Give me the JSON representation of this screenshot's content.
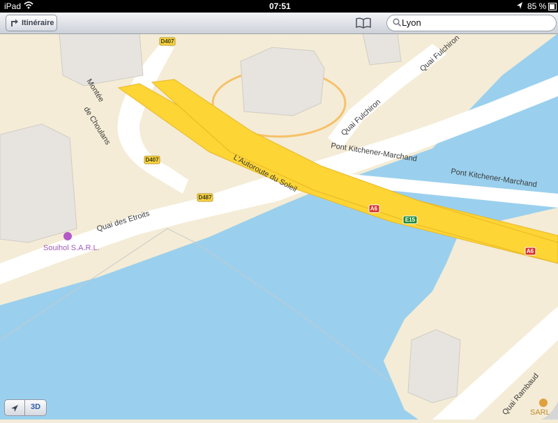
{
  "status": {
    "device": "iPad",
    "time": "07:51",
    "battery": "85 %",
    "wifi_icon": "wifi-icon",
    "location_icon": "location-arrow-icon"
  },
  "toolbar": {
    "directions_label": "Itinéraire",
    "bookmarks_icon": "bookmarks-icon",
    "search_value": "Lyon"
  },
  "map": {
    "streets": {
      "montee_1": "Montée",
      "montee_2": "de Choulans",
      "quai_fulchiron_1": "Quai Fulchiron",
      "quai_fulchiron_2": "Quai Fulchiron",
      "pont_1": "Pont Kitchener-Marchand",
      "pont_2": "Pont Kitchener-Marchand",
      "autoroute": "L'Autoroute du Soleil",
      "quai_etroits": "Quai des Etroits",
      "quai_rambaud": "Quai Rambaud"
    },
    "shields": {
      "d407_a": "D407",
      "d407_b": "D407",
      "d487": "D487",
      "a6_a": "A6",
      "a6_b": "A6",
      "e15": "E15"
    },
    "poi": {
      "souihol": "Souihol S.A.R.L.",
      "sarl": "SARL"
    },
    "colors": {
      "water": "#9ad0ee",
      "land": "#f4ecd6",
      "highway": "#fdd534",
      "building": "#e7e4df"
    }
  },
  "controls": {
    "locate_icon": "location-arrow-icon",
    "threed_label": "3D"
  }
}
